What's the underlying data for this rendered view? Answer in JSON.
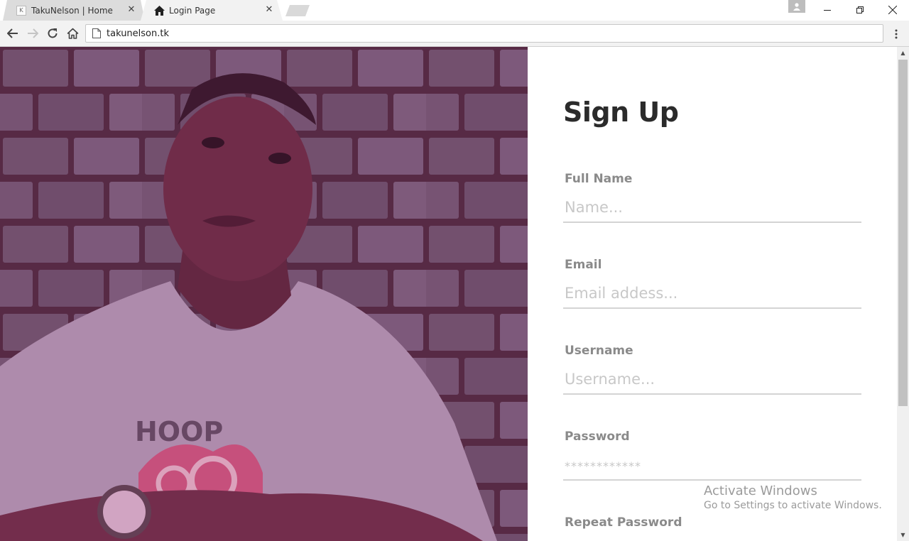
{
  "browser": {
    "tabs": [
      {
        "title": "TakuNelson | Home",
        "favicon": "k-favicon",
        "active": false
      },
      {
        "title": "Login Page",
        "favicon": "home-icon",
        "active": true
      }
    ],
    "close_glyph": "✕",
    "url": "takunelson.tk",
    "window_controls": {
      "minimize": "—",
      "restore": "❐",
      "close": "✕"
    }
  },
  "form": {
    "title": "Sign Up",
    "fields": [
      {
        "label": "Full Name",
        "placeholder": "Name..."
      },
      {
        "label": "Email",
        "placeholder": "Email addess..."
      },
      {
        "label": "Username",
        "placeholder": "Username..."
      },
      {
        "label": "Password",
        "placeholder": "************"
      },
      {
        "label": "Repeat Password",
        "placeholder": ""
      }
    ]
  },
  "photo": {
    "shirt_text": "HOOP",
    "overlay_color": "#8a2f6a"
  },
  "watermark": {
    "title": "Activate Windows",
    "subtitle": "Go to Settings to activate Windows."
  },
  "colors": {
    "heading": "#2b2b2b",
    "label": "#8a8a8a",
    "placeholder": "#c8c8c8",
    "underline": "#d4d4d4"
  }
}
